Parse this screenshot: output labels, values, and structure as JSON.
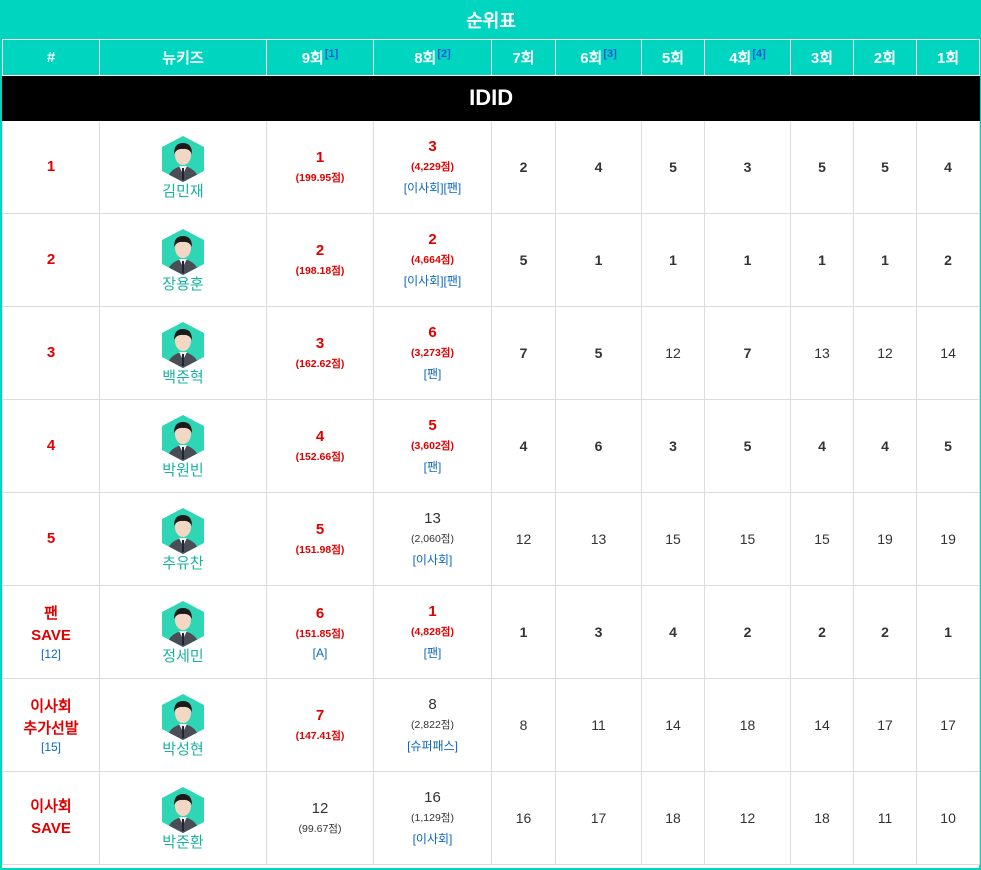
{
  "table_title": "순위표",
  "columns": [
    {
      "label": "#",
      "sup": ""
    },
    {
      "label": "뉴키즈",
      "sup": ""
    },
    {
      "label": "9회",
      "sup": "[1]"
    },
    {
      "label": "8회",
      "sup": "[2]"
    },
    {
      "label": "7회",
      "sup": ""
    },
    {
      "label": "6회",
      "sup": "[3]"
    },
    {
      "label": "5회",
      "sup": ""
    },
    {
      "label": "4회",
      "sup": "[4]"
    },
    {
      "label": "3회",
      "sup": ""
    },
    {
      "label": "2회",
      "sup": ""
    },
    {
      "label": "1회",
      "sup": ""
    }
  ],
  "group_name": "IDID",
  "colors": {
    "header_bg": "#00d5c0",
    "highlight_red": "#e00000",
    "link_blue": "#0b67c2",
    "name_teal": "#18b3a0",
    "avatar_hex": "#2fd6b6"
  },
  "rows": [
    {
      "rank_lines": [
        "1"
      ],
      "rank_note": "",
      "avatar_icon": "member-photo-icon",
      "name": "김민재",
      "ep9": {
        "rank": "1",
        "points": "(199.95점)",
        "note": "",
        "red": true
      },
      "ep8": {
        "rank": "3",
        "points": "(4,229점)",
        "note": "[이사회][팬]",
        "red": true
      },
      "episodes": [
        {
          "v": "2",
          "red": true
        },
        {
          "v": "4",
          "red": true
        },
        {
          "v": "5",
          "red": true
        },
        {
          "v": "3",
          "red": true
        },
        {
          "v": "5",
          "red": true
        },
        {
          "v": "5",
          "red": true
        },
        {
          "v": "4",
          "red": true
        }
      ]
    },
    {
      "rank_lines": [
        "2"
      ],
      "rank_note": "",
      "avatar_icon": "member-photo-icon",
      "name": "장용훈",
      "ep9": {
        "rank": "2",
        "points": "(198.18점)",
        "note": "",
        "red": true
      },
      "ep8": {
        "rank": "2",
        "points": "(4,664점)",
        "note": "[이사회][팬]",
        "red": true
      },
      "episodes": [
        {
          "v": "5",
          "red": true
        },
        {
          "v": "1",
          "red": true
        },
        {
          "v": "1",
          "red": true
        },
        {
          "v": "1",
          "red": true
        },
        {
          "v": "1",
          "red": true
        },
        {
          "v": "1",
          "red": true
        },
        {
          "v": "2",
          "red": true
        }
      ]
    },
    {
      "rank_lines": [
        "3"
      ],
      "rank_note": "",
      "avatar_icon": "member-photo-icon",
      "name": "백준혁",
      "ep9": {
        "rank": "3",
        "points": "(162.62점)",
        "note": "",
        "red": true
      },
      "ep8": {
        "rank": "6",
        "points": "(3,273점)",
        "note": "[팬]",
        "red": true
      },
      "episodes": [
        {
          "v": "7",
          "red": true
        },
        {
          "v": "5",
          "red": true
        },
        {
          "v": "12",
          "red": false
        },
        {
          "v": "7",
          "red": true
        },
        {
          "v": "13",
          "red": false
        },
        {
          "v": "12",
          "red": false
        },
        {
          "v": "14",
          "red": false
        }
      ]
    },
    {
      "rank_lines": [
        "4"
      ],
      "rank_note": "",
      "avatar_icon": "member-photo-icon",
      "name": "박원빈",
      "ep9": {
        "rank": "4",
        "points": "(152.66점)",
        "note": "",
        "red": true
      },
      "ep8": {
        "rank": "5",
        "points": "(3,602점)",
        "note": "[팬]",
        "red": true
      },
      "episodes": [
        {
          "v": "4",
          "red": true
        },
        {
          "v": "6",
          "red": true
        },
        {
          "v": "3",
          "red": true
        },
        {
          "v": "5",
          "red": true
        },
        {
          "v": "4",
          "red": true
        },
        {
          "v": "4",
          "red": true
        },
        {
          "v": "5",
          "red": true
        }
      ]
    },
    {
      "rank_lines": [
        "5"
      ],
      "rank_note": "",
      "avatar_icon": "member-photo-icon",
      "name": "추유찬",
      "ep9": {
        "rank": "5",
        "points": "(151.98점)",
        "note": "",
        "red": true
      },
      "ep8": {
        "rank": "13",
        "points": "(2,060점)",
        "note": "[이사회]",
        "red": false
      },
      "episodes": [
        {
          "v": "12",
          "red": false
        },
        {
          "v": "13",
          "red": false
        },
        {
          "v": "15",
          "red": false
        },
        {
          "v": "15",
          "red": false
        },
        {
          "v": "15",
          "red": false
        },
        {
          "v": "19",
          "red": false
        },
        {
          "v": "19",
          "red": false
        }
      ]
    },
    {
      "rank_lines": [
        "팬",
        "SAVE"
      ],
      "rank_note": "[12]",
      "avatar_icon": "member-photo-icon",
      "name": "정세민",
      "ep9": {
        "rank": "6",
        "points": "(151.85점)",
        "note": "[A]",
        "red": true
      },
      "ep8": {
        "rank": "1",
        "points": "(4,828점)",
        "note": "[팬]",
        "red": true
      },
      "episodes": [
        {
          "v": "1",
          "red": true
        },
        {
          "v": "3",
          "red": true
        },
        {
          "v": "4",
          "red": true
        },
        {
          "v": "2",
          "red": true
        },
        {
          "v": "2",
          "red": true
        },
        {
          "v": "2",
          "red": true
        },
        {
          "v": "1",
          "red": true
        }
      ]
    },
    {
      "rank_lines": [
        "이사회",
        "추가선발"
      ],
      "rank_note": "[15]",
      "avatar_icon": "member-photo-icon",
      "name": "박성현",
      "ep9": {
        "rank": "7",
        "points": "(147.41점)",
        "note": "",
        "red": true
      },
      "ep8": {
        "rank": "8",
        "points": "(2,822점)",
        "note": "[슈퍼패스]",
        "red": false
      },
      "episodes": [
        {
          "v": "8",
          "red": false
        },
        {
          "v": "11",
          "red": false
        },
        {
          "v": "14",
          "red": false
        },
        {
          "v": "18",
          "red": false
        },
        {
          "v": "14",
          "red": false
        },
        {
          "v": "17",
          "red": false
        },
        {
          "v": "17",
          "red": false
        }
      ]
    },
    {
      "rank_lines": [
        "이사회",
        "SAVE"
      ],
      "rank_note": "",
      "avatar_icon": "member-photo-icon",
      "name": "박준환",
      "ep9": {
        "rank": "12",
        "points": "(99.67점)",
        "note": "",
        "red": false
      },
      "ep8": {
        "rank": "16",
        "points": "(1,129점)",
        "note": "[이사회]",
        "red": false
      },
      "episodes": [
        {
          "v": "16",
          "red": false
        },
        {
          "v": "17",
          "red": false
        },
        {
          "v": "18",
          "red": false
        },
        {
          "v": "12",
          "red": false
        },
        {
          "v": "18",
          "red": false
        },
        {
          "v": "11",
          "red": false
        },
        {
          "v": "10",
          "red": false
        }
      ]
    }
  ]
}
